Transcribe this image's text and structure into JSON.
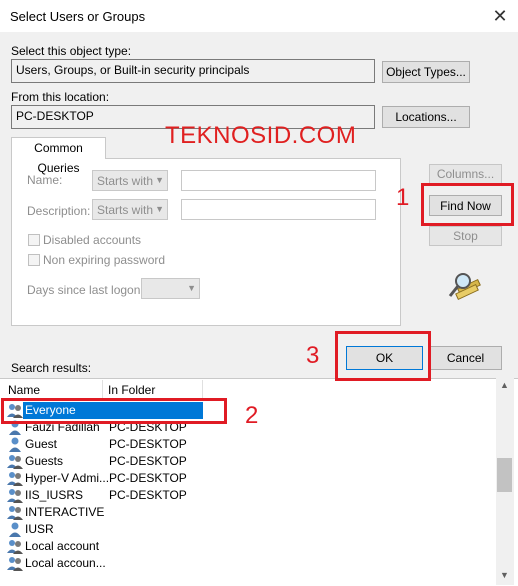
{
  "window": {
    "title": "Select Users or Groups",
    "close_glyph": "✕"
  },
  "object_type": {
    "label": "Select this object type:",
    "value": "Users, Groups, or Built-in security principals",
    "button": "Object Types..."
  },
  "location": {
    "label": "From this location:",
    "value": "PC-DESKTOP",
    "button": "Locations..."
  },
  "tab": {
    "label": "Common Queries"
  },
  "queries": {
    "name_label": "Name:",
    "name_mode": "Starts with",
    "desc_label": "Description:",
    "desc_mode": "Starts with",
    "disabled_accounts": "Disabled accounts",
    "non_expiring": "Non expiring password",
    "days_label": "Days since last logon:"
  },
  "buttons": {
    "columns": "Columns...",
    "find_now": "Find Now",
    "stop": "Stop",
    "ok": "OK",
    "cancel": "Cancel"
  },
  "watermark": "TEKNOSID.COM",
  "annotations": {
    "n1": "1",
    "n2": "2",
    "n3": "3"
  },
  "results": {
    "label": "Search results:",
    "columns": [
      "Name",
      "In Folder"
    ],
    "rows": [
      {
        "name": "Everyone",
        "folder": "",
        "icon": "group-icon"
      },
      {
        "name": "Fauzi Fadillah",
        "folder": "PC-DESKTOP",
        "icon": "user-icon"
      },
      {
        "name": "Guest",
        "folder": "PC-DESKTOP",
        "icon": "user-icon"
      },
      {
        "name": "Guests",
        "folder": "PC-DESKTOP",
        "icon": "group-icon"
      },
      {
        "name": "Hyper-V Admi...",
        "folder": "PC-DESKTOP",
        "icon": "group-icon"
      },
      {
        "name": "IIS_IUSRS",
        "folder": "PC-DESKTOP",
        "icon": "group-icon"
      },
      {
        "name": "INTERACTIVE",
        "folder": "",
        "icon": "group-icon"
      },
      {
        "name": "IUSR",
        "folder": "",
        "icon": "user-icon"
      },
      {
        "name": "Local account",
        "folder": "",
        "icon": "group-icon"
      },
      {
        "name": "Local accoun...",
        "folder": "",
        "icon": "group-icon"
      }
    ]
  },
  "colors": {
    "selection": "#0078d7",
    "annotation_red": "#e01b24"
  }
}
